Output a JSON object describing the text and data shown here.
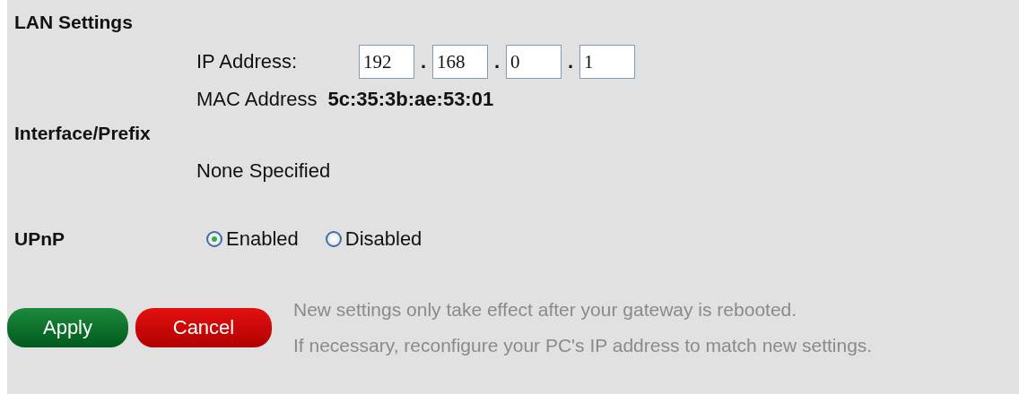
{
  "lan_settings": {
    "heading": "LAN Settings",
    "ip_label": "IP Address:",
    "ip_octets": [
      "192",
      "168",
      "0",
      "1"
    ],
    "ip_separator": ".",
    "mac_label": "MAC Address",
    "mac_value": "5c:35:3b:ae:53:01"
  },
  "interface_prefix": {
    "heading": "Interface/Prefix",
    "value": "None Specified"
  },
  "upnp": {
    "heading": "UPnP",
    "options": [
      {
        "label": "Enabled",
        "selected": true
      },
      {
        "label": "Disabled",
        "selected": false
      }
    ]
  },
  "buttons": [
    {
      "label": "Apply",
      "kind": "apply"
    },
    {
      "label": "Cancel",
      "kind": "cancel"
    }
  ],
  "notes": [
    "New settings only take effect after your gateway is rebooted.",
    "If necessary, reconfigure your PC's IP address to match new settings."
  ]
}
